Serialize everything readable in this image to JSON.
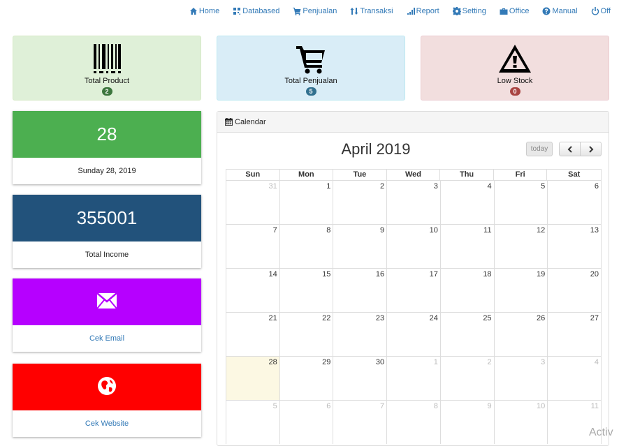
{
  "nav": [
    {
      "label": "Home",
      "icon": "home-icon"
    },
    {
      "label": "Databased",
      "icon": "qrcode-icon"
    },
    {
      "label": "Penjualan",
      "icon": "cart-icon"
    },
    {
      "label": "Transaksi",
      "icon": "sort-icon"
    },
    {
      "label": "Report",
      "icon": "signal-icon"
    },
    {
      "label": "Setting",
      "icon": "gear-icon"
    },
    {
      "label": "Office",
      "icon": "briefcase-icon"
    },
    {
      "label": "Manual",
      "icon": "question-icon"
    },
    {
      "label": "Off",
      "icon": "power-icon"
    }
  ],
  "stats": {
    "product": {
      "label": "Total Product",
      "count": "2",
      "badge_color": "#3c763d",
      "bg": "#dff0d8",
      "border": "#d6e9c6"
    },
    "sales": {
      "label": "Total Penjualan",
      "count": "5",
      "badge_color": "#31708f",
      "bg": "#d9edf7",
      "border": "#bce8f1"
    },
    "stock": {
      "label": "Low Stock",
      "count": "0",
      "badge_color": "#a94442",
      "bg": "#f2dede",
      "border": "#ebccd1"
    }
  },
  "tiles": {
    "date": {
      "value": "28",
      "caption": "Sunday 28, 2019",
      "color": "#4caf50"
    },
    "income": {
      "value": "355001",
      "caption": "Total Income",
      "color": "#22527b"
    },
    "email": {
      "caption": "Cek Email",
      "color": "#b600ff"
    },
    "website": {
      "caption": "Cek Website",
      "color": "#ff0000"
    }
  },
  "calendar": {
    "panel_title": "Calendar",
    "month_title": "April 2019",
    "today_label": "today",
    "weekdays": [
      "Sun",
      "Mon",
      "Tue",
      "Wed",
      "Thu",
      "Fri",
      "Sat"
    ],
    "weeks": [
      [
        {
          "d": "31",
          "o": true
        },
        {
          "d": "1"
        },
        {
          "d": "2"
        },
        {
          "d": "3"
        },
        {
          "d": "4"
        },
        {
          "d": "5"
        },
        {
          "d": "6"
        }
      ],
      [
        {
          "d": "7"
        },
        {
          "d": "8"
        },
        {
          "d": "9"
        },
        {
          "d": "10"
        },
        {
          "d": "11"
        },
        {
          "d": "12"
        },
        {
          "d": "13"
        }
      ],
      [
        {
          "d": "14"
        },
        {
          "d": "15"
        },
        {
          "d": "16"
        },
        {
          "d": "17"
        },
        {
          "d": "18"
        },
        {
          "d": "19"
        },
        {
          "d": "20"
        }
      ],
      [
        {
          "d": "21"
        },
        {
          "d": "22"
        },
        {
          "d": "23"
        },
        {
          "d": "24"
        },
        {
          "d": "25"
        },
        {
          "d": "26"
        },
        {
          "d": "27"
        }
      ],
      [
        {
          "d": "28",
          "t": true
        },
        {
          "d": "29"
        },
        {
          "d": "30"
        },
        {
          "d": "1",
          "o": true
        },
        {
          "d": "2",
          "o": true
        },
        {
          "d": "3",
          "o": true
        },
        {
          "d": "4",
          "o": true
        }
      ],
      [
        {
          "d": "5",
          "o": true
        },
        {
          "d": "6",
          "o": true
        },
        {
          "d": "7",
          "o": true
        },
        {
          "d": "8",
          "o": true
        },
        {
          "d": "9",
          "o": true
        },
        {
          "d": "10",
          "o": true
        },
        {
          "d": "11",
          "o": true
        }
      ]
    ]
  },
  "watermark": "Activ"
}
